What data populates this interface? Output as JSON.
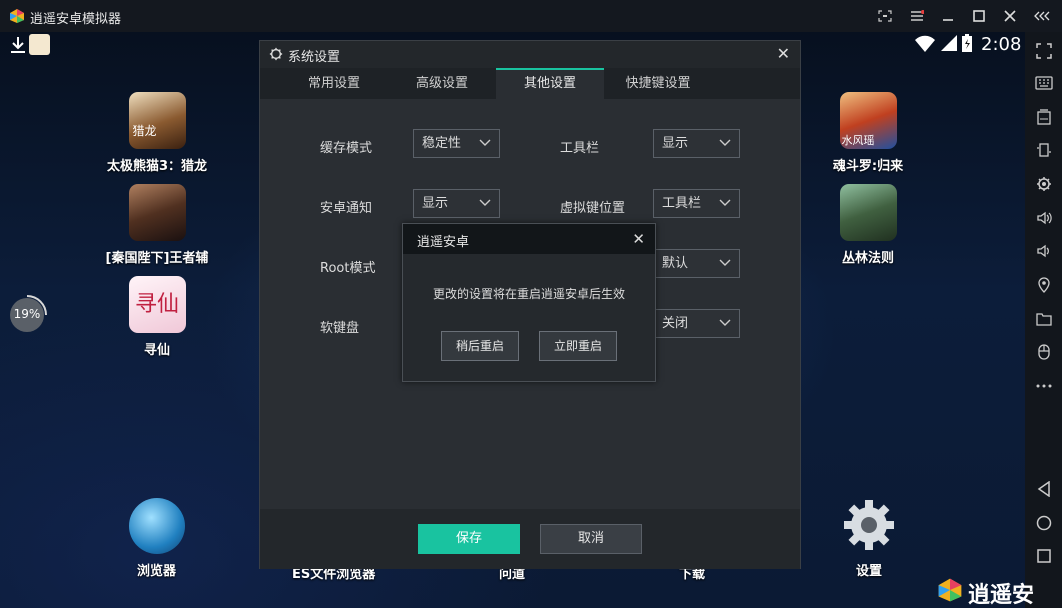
{
  "window": {
    "title": "逍遥安卓模拟器",
    "controls": [
      "fullscreen-icon",
      "menu-icon",
      "minimize-icon",
      "maximize-icon",
      "close-icon",
      "collapse-icon"
    ]
  },
  "status_bar": {
    "time": "2:08"
  },
  "progress": {
    "percent": 19,
    "label": "19%"
  },
  "apps_left": [
    {
      "label": "太极熊猫3：猎龙",
      "badge": "猎龙"
    },
    {
      "label": "[秦国陛下]王者辅"
    },
    {
      "label": "寻仙",
      "art": "寻仙"
    }
  ],
  "apps_right": [
    {
      "label": "魂斗罗:归来",
      "badge": "水风瑶"
    },
    {
      "label": "丛林法则"
    }
  ],
  "dock": {
    "browser": "浏览器",
    "es": "ES文件浏览器",
    "q": "问道",
    "download": "下载",
    "settings": "设置"
  },
  "settings": {
    "title": "系统设置",
    "tabs": [
      "常用设置",
      "高级设置",
      "其他设置",
      "快捷键设置"
    ],
    "active_tab": 2,
    "rows": {
      "cache_label": "缓存模式",
      "cache_value": "稳定性",
      "toolbar_label": "工具栏",
      "toolbar_value": "显示",
      "notify_label": "安卓通知",
      "notify_value": "显示",
      "vkey_label": "虚拟键位置",
      "vkey_value": "工具栏",
      "root_label": "Root模式",
      "root_value": "默认",
      "softkb_label": "软键盘",
      "softkb_value": "关闭"
    },
    "save": "保存",
    "cancel": "取消"
  },
  "confirm": {
    "title": "逍遥安卓",
    "message": "更改的设置将在重启逍遥安卓后生效",
    "later": "稍后重启",
    "now": "立即重启"
  },
  "brand": "逍遥安",
  "colors": {
    "accent": "#19c3a0",
    "panel": "#2a2e33"
  }
}
